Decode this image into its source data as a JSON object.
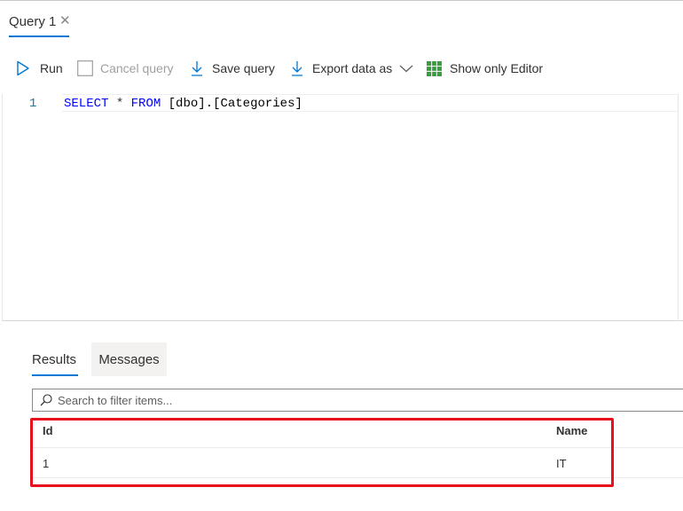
{
  "tab": {
    "title": "Query 1",
    "close": "✕"
  },
  "toolbar": {
    "run": "Run",
    "cancel": "Cancel query",
    "save": "Save query",
    "export": "Export data as",
    "show_editor": "Show only Editor"
  },
  "editor": {
    "line_number": "1",
    "code": {
      "select": "SELECT",
      "star": "*",
      "from": "FROM",
      "rest": "[dbo].[Categories]"
    }
  },
  "results": {
    "tabs": {
      "results": "Results",
      "messages": "Messages"
    },
    "search_placeholder": "Search to filter items...",
    "columns": [
      "Id",
      "Name"
    ],
    "rows": [
      [
        "1",
        "IT"
      ]
    ]
  },
  "colors": {
    "accent": "#0078d4",
    "highlight": "#e8101d",
    "keyword": "#0000ff",
    "grid_icon": "#3a9c3f"
  }
}
